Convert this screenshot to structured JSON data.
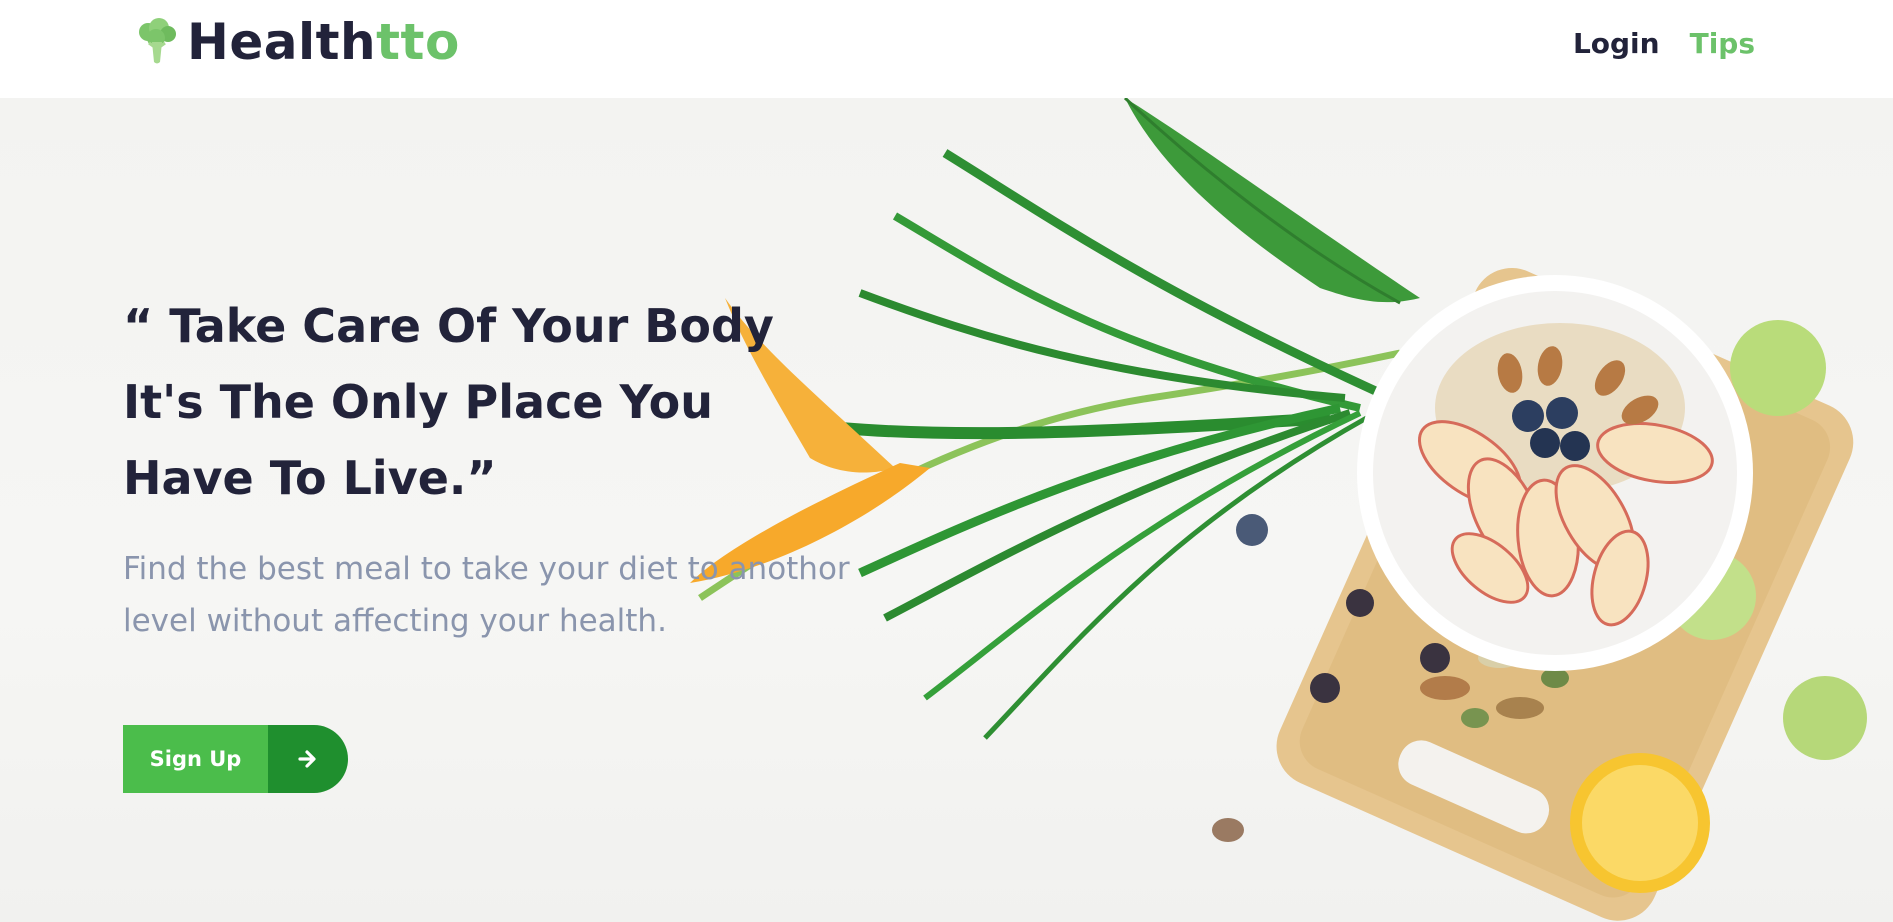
{
  "brand": {
    "name_part1": "Health",
    "name_part2": "tto",
    "icon": "broccoli-icon"
  },
  "nav": {
    "login_label": "Login",
    "tips_label": "Tips"
  },
  "hero": {
    "headline": "“ Take Care Of Your Body It's The Only Place You Have To Live.”",
    "subtext": "Find the best meal to take your diet to anothor level without affecting your health.",
    "cta_label": "Sign Up",
    "cta_icon": "arrow-right-icon"
  },
  "colors": {
    "brand_dark": "#22233a",
    "brand_green": "#6cc26a",
    "cta_green": "#4bbd4b",
    "cta_dark_green": "#1f8f2e",
    "subtext_gray": "#8a95ad"
  }
}
